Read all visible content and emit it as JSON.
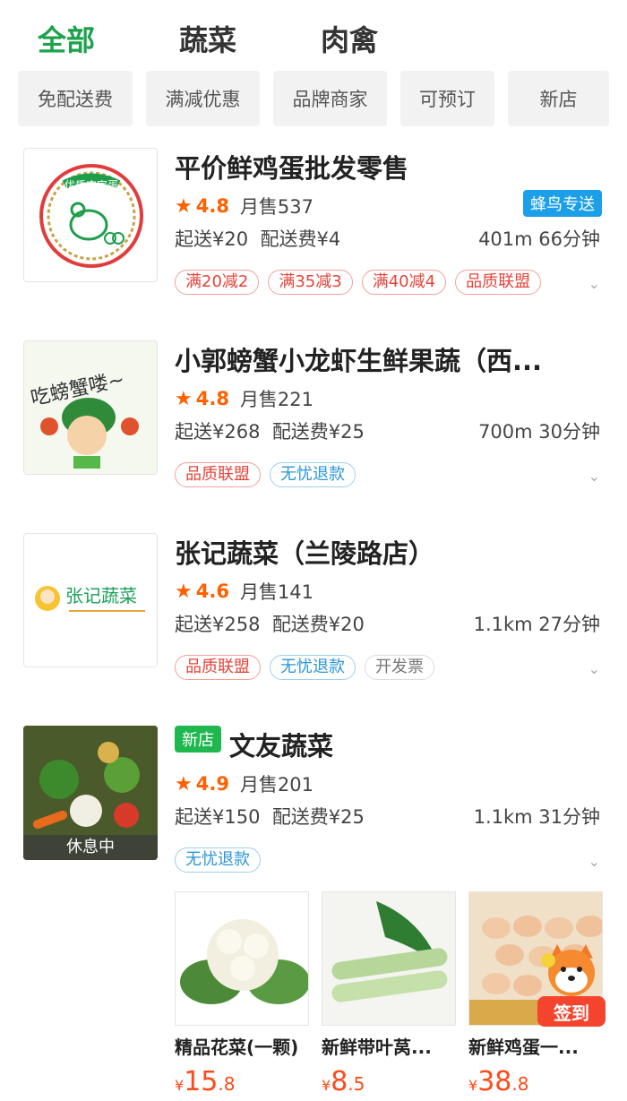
{
  "tabs": [
    {
      "label": "全部",
      "active": true
    },
    {
      "label": "蔬菜",
      "active": false
    },
    {
      "label": "肉禽",
      "active": false
    }
  ],
  "filters": [
    "免配送费",
    "满减优惠",
    "品牌商家",
    "可预订",
    "新店"
  ],
  "shops": [
    {
      "name": "平价鲜鸡蛋批发零售",
      "logo_text": "优质农家蛋",
      "rating": "4.8",
      "monthly_sales": "月售537",
      "delivery_badge": "蜂鸟专送",
      "min_order": "起送¥20",
      "delivery_fee": "配送费¥4",
      "distance_time": "401m 66分钟",
      "tags": [
        "满20减2",
        "满35减3",
        "满40减4",
        "品质联盟"
      ]
    },
    {
      "name": "小郭螃蟹小龙虾生鲜果蔬（西...",
      "logo_text": "吃螃蟹喽~",
      "rating": "4.8",
      "monthly_sales": "月售221",
      "min_order": "起送¥268",
      "delivery_fee": "配送费¥25",
      "distance_time": "700m 30分钟",
      "tags": [
        "品质联盟",
        "无忧退款"
      ]
    },
    {
      "name": "张记蔬菜（兰陵路店）",
      "logo_text": "张记蔬菜",
      "rating": "4.6",
      "monthly_sales": "月售141",
      "min_order": "起送¥258",
      "delivery_fee": "配送费¥20",
      "distance_time": "1.1km 27分钟",
      "tags": [
        "品质联盟",
        "无忧退款",
        "开发票"
      ]
    },
    {
      "name": "文友蔬菜",
      "new_badge": "新店",
      "status": "休息中",
      "rating": "4.9",
      "monthly_sales": "月售201",
      "min_order": "起送¥150",
      "delivery_fee": "配送费¥25",
      "distance_time": "1.1km 31分钟",
      "tags": [
        "无忧退款"
      ]
    }
  ],
  "products": [
    {
      "name": "精品花菜(一颗)",
      "currency": "¥",
      "price_int": "15",
      "price_dec": ".8"
    },
    {
      "name": "新鲜带叶莴...",
      "currency": "¥",
      "price_int": "8",
      "price_dec": ".5"
    },
    {
      "name": "新鲜鸡蛋一...",
      "currency": "¥",
      "price_int": "38",
      "price_dec": ".8"
    }
  ],
  "checkin_label": "签到",
  "star_glyph": "★",
  "chevron_glyph": "⌄",
  "colors": {
    "accent": "#1ea14d",
    "rating": "#ff6000",
    "price": "#ff4a1a",
    "delivery": "#1a9fe8"
  }
}
